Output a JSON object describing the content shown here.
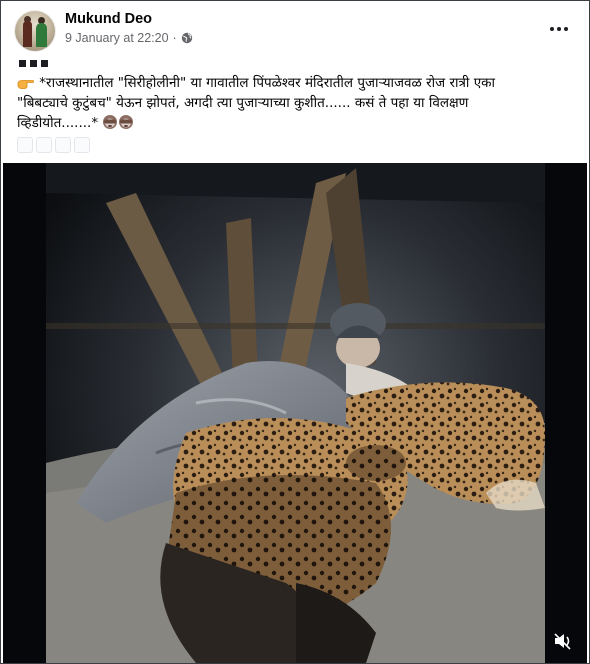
{
  "post": {
    "author": "Mukund Deo",
    "timestamp": "9 January at 22:20",
    "separator": "·",
    "privacy_icon": "globe-icon",
    "menu_icon": "more-horizontal-icon",
    "text_line1": "*राजस्थानातील \"सिरीहोलीनी\" या गावातील पिंपळेश्वर मंदिरातील पुजाऱ्याजवळ रोज रात्री एका",
    "text_line2": "\"बिबट्याचे कुटुंबच\" येऊन झोपतं, अगदी त्या पुजाऱ्याच्या कुशीत...... कसं ते पहा या विलक्षण",
    "text_line3": "व्हिडीयोत.......*"
  },
  "video": {
    "mute_icon": "volume-muted-icon",
    "accent_dark": "#05070a"
  },
  "colors": {
    "author_text": "#050505",
    "meta_text": "#65676b",
    "border": "#3a3f46"
  }
}
